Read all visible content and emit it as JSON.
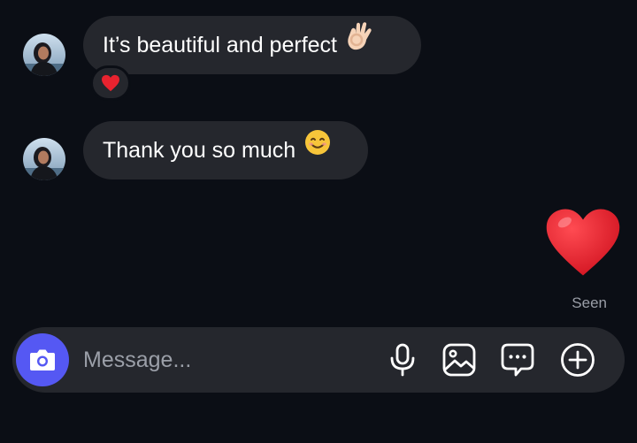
{
  "thread": {
    "messages": [
      {
        "text": "It’s beautiful and perfect",
        "emoji": "ok-hand-emoji",
        "reaction": "red-heart-emoji"
      },
      {
        "text": "Thank you so much",
        "emoji": "smiling-face-emoji"
      }
    ],
    "sent_item": "red-heart-emoji",
    "seen_label": "Seen"
  },
  "composer": {
    "placeholder": "Message...",
    "value": "",
    "icons": [
      "camera-icon",
      "microphone-icon",
      "gallery-icon",
      "sticker-chat-icon",
      "plus-circle-icon"
    ]
  },
  "colors": {
    "background": "#0b0e15",
    "bubble": "#25272d",
    "camera_button": "#5558f3",
    "seen_text": "#9a9ea7",
    "heart": "#e8232f"
  }
}
